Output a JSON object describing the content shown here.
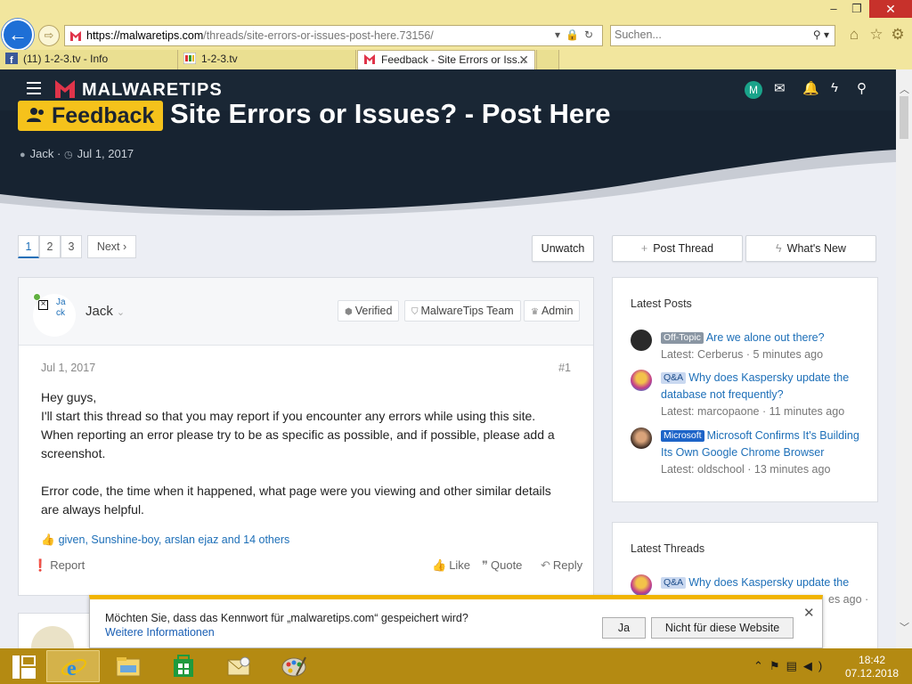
{
  "browser": {
    "url_domain": "https://malwaretips.com",
    "url_path": "/threads/site-errors-or-issues-post-here.73156/",
    "search_placeholder": "Suchen...",
    "tabs": [
      {
        "label": "(11) 1-2-3.tv - Info"
      },
      {
        "label": "1-2-3.tv"
      },
      {
        "label": "Feedback - Site Errors or Iss..."
      }
    ],
    "window": {
      "minimize": "–",
      "maximize": "❐",
      "close": "✕"
    }
  },
  "site": {
    "logo": "MALWARETIPS",
    "user_initial": "M",
    "accent": "#f5c21b"
  },
  "thread": {
    "prefix": "Feedback",
    "title": "Site Errors or Issues? - Post Here",
    "author": "Jack",
    "date": "Jul 1, 2017"
  },
  "pagination": {
    "pages": [
      "1",
      "2",
      "3"
    ],
    "next": "Next ›"
  },
  "buttons": {
    "unwatch": "Unwatch",
    "post_thread": "Post Thread",
    "whats_new": "What's New"
  },
  "post": {
    "avatar_text": "Ja ck",
    "author": "Jack",
    "roles": [
      "Verified",
      "MalwareTips Team",
      "Admin"
    ],
    "date": "Jul 1, 2017",
    "number": "#1",
    "body": [
      "Hey guys,",
      "I'll start this thread so that you may report if you encounter any errors while using this site.",
      "When reporting an error please try to be as specific as possible, and if possible, please add a screenshot.",
      "Error code, the time when it happened, what page were you viewing and other similar details are always helpful."
    ],
    "reactions": "given, Sunshine-boy, arslan ejaz and 14 others",
    "actions": {
      "report": "Report",
      "like": "Like",
      "quote": "Quote",
      "reply": "Reply"
    }
  },
  "sidebar": {
    "latest_posts_title": "Latest Posts",
    "latest_posts": [
      {
        "tag": "Off-Topic",
        "title": "Are we alone out there?",
        "sub": "Latest: Cerberus · 5 minutes ago"
      },
      {
        "tag": "Q&A",
        "title": "Why does Kaspersky update the database not frequently?",
        "sub": "Latest: marcopaone · 11 minutes ago"
      },
      {
        "tag": "Microsoft",
        "title": "Microsoft Confirms It's Building Its Own Google Chrome Browser",
        "sub": "Latest: oldschool · 13 minutes ago"
      }
    ],
    "latest_threads_title": "Latest Threads",
    "latest_threads": [
      {
        "tag": "Q&A",
        "title": "Why does Kaspersky update the",
        "sub_partial": "es ago ·"
      }
    ]
  },
  "password_bar": {
    "message": "Möchten Sie, dass das Kennwort für „malwaretips.com“ gespeichert wird?",
    "link": "Weitere Informationen",
    "yes": "Ja",
    "no": "Nicht für diese Website",
    "close": "✕"
  },
  "taskbar": {
    "time": "18:42",
    "date": "07.12.2018"
  }
}
